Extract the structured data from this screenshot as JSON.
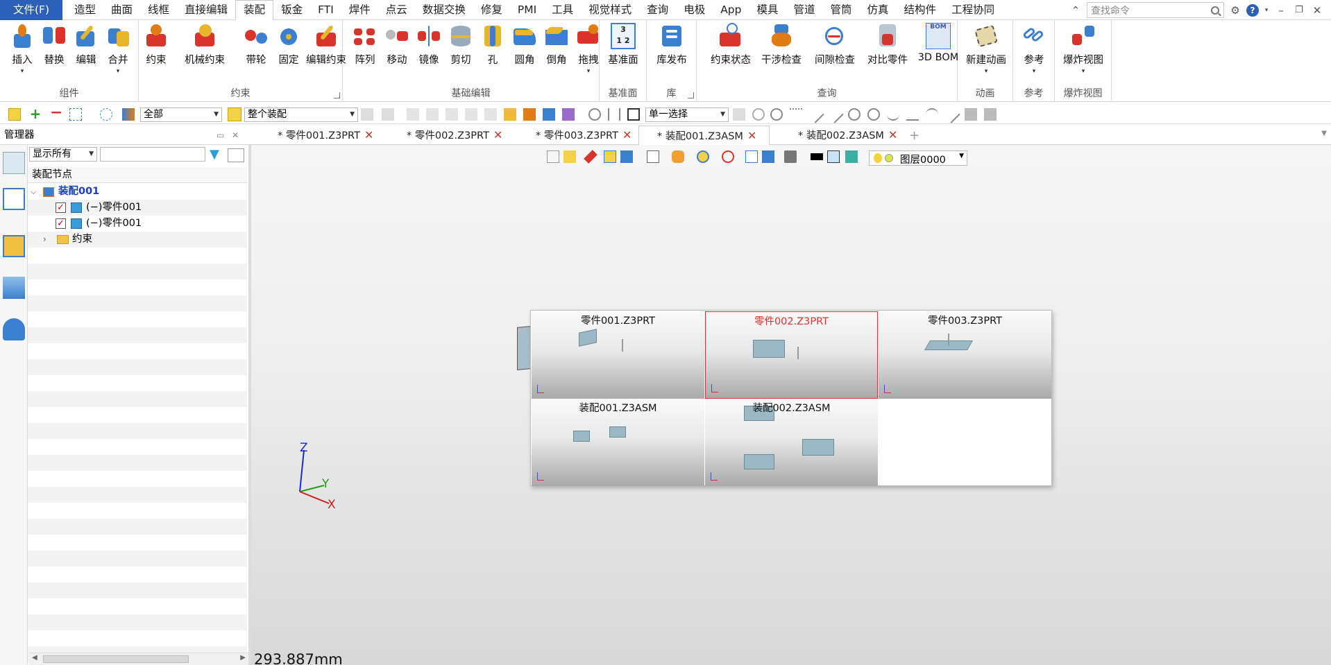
{
  "menubar": {
    "file": "文件(F)",
    "items": [
      "造型",
      "曲面",
      "线框",
      "直接编辑",
      "装配",
      "钣金",
      "FTI",
      "焊件",
      "点云",
      "数据交换",
      "修复",
      "PMI",
      "工具",
      "视觉样式",
      "查询",
      "电极",
      "App",
      "模具",
      "管道",
      "管筒",
      "仿真",
      "结构件",
      "工程协同"
    ],
    "active": "装配",
    "search_placeholder": "查找命令"
  },
  "ribbon": {
    "groups": [
      {
        "name": "组件",
        "buttons": [
          "插入",
          "替换",
          "编辑",
          "合并"
        ]
      },
      {
        "name": "约束",
        "buttons": [
          "约束",
          "机械约束",
          "带轮",
          "固定",
          "编辑约束"
        ]
      },
      {
        "name": "基础编辑",
        "buttons": [
          "阵列",
          "移动",
          "镜像",
          "剪切",
          "孔",
          "圆角",
          "倒角",
          "拖拽"
        ]
      },
      {
        "name": "基准面",
        "buttons": [
          "基准面"
        ]
      },
      {
        "name": "库",
        "buttons": [
          "库发布"
        ]
      },
      {
        "name": "查询",
        "buttons": [
          "约束状态",
          "干涉检查",
          "间隙检查",
          "对比零件",
          "3D BOM"
        ]
      },
      {
        "name": "动画",
        "buttons": [
          "新建动画"
        ]
      },
      {
        "name": "参考",
        "buttons": [
          "参考"
        ]
      },
      {
        "name": "爆炸视图",
        "buttons": [
          "爆炸视图"
        ]
      }
    ]
  },
  "toolbar2": {
    "filter_combo": "全部",
    "scope_combo": "整个装配",
    "select_combo": "单一选择"
  },
  "manager": {
    "title": "管理器",
    "display_combo": "显示所有",
    "header": "装配节点",
    "root": "装配001",
    "children": [
      "(−)零件001",
      "(−)零件001"
    ],
    "folder": "约束"
  },
  "tabs": [
    {
      "label": "* 零件001.Z3PRT",
      "active": false
    },
    {
      "label": "* 零件002.Z3PRT",
      "active": false
    },
    {
      "label": "* 零件003.Z3PRT",
      "active": false
    },
    {
      "label": "* 装配001.Z3ASM",
      "active": true
    },
    {
      "label": "* 装配002.Z3ASM",
      "active": false
    }
  ],
  "viewport": {
    "layer_combo": "图层0000",
    "scale": "293.887mm",
    "axes": {
      "x": "X",
      "y": "Y",
      "z": "Z"
    }
  },
  "switcher": {
    "items": [
      {
        "label": "零件001.Z3PRT",
        "selected": false
      },
      {
        "label": "零件002.Z3PRT",
        "selected": true
      },
      {
        "label": "零件003.Z3PRT",
        "selected": false
      },
      {
        "label": "装配001.Z3ASM",
        "selected": false
      },
      {
        "label": "装配002.Z3ASM",
        "selected": false
      }
    ]
  },
  "colors": {
    "accent": "#2b5fb8",
    "selected": "#e0302a",
    "part": "#9bb8c4"
  }
}
